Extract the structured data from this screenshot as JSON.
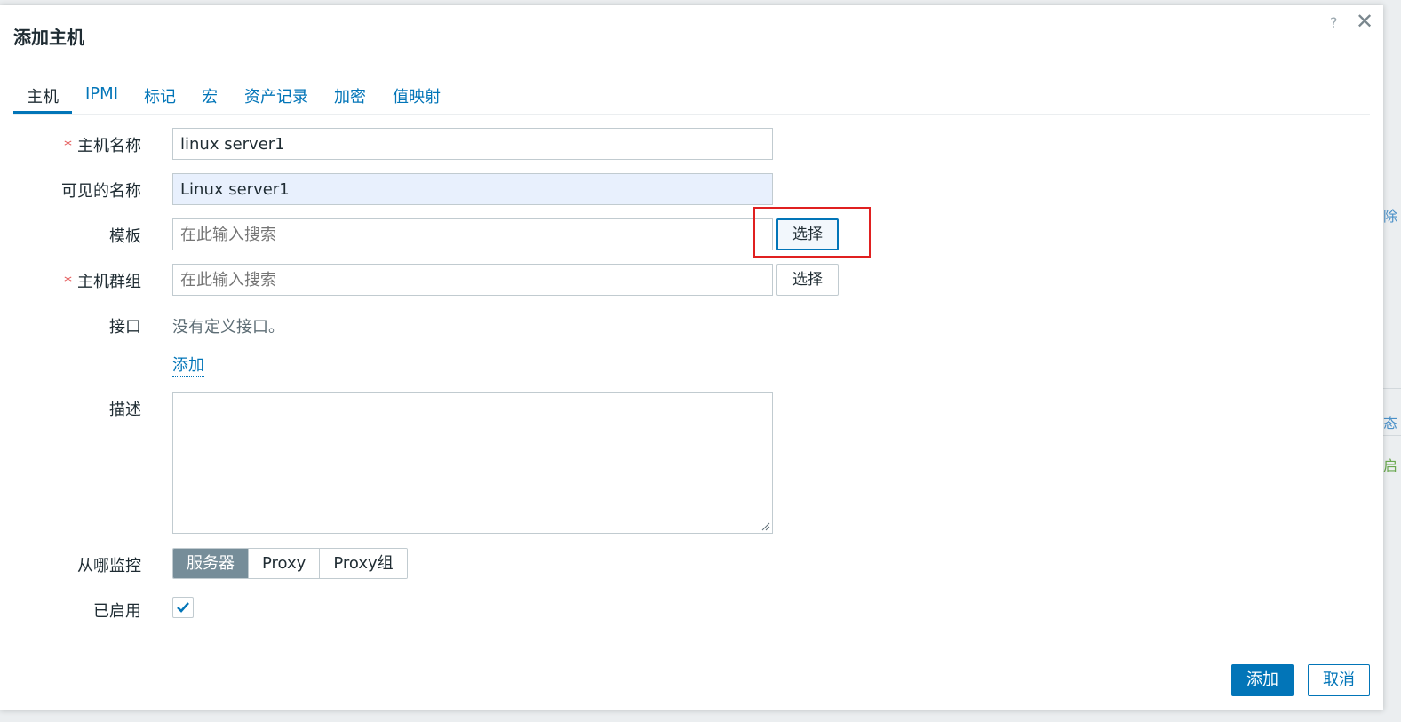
{
  "dialog": {
    "title": "添加主机",
    "help_glyph": "?",
    "close_glyph": "✕"
  },
  "tabs": [
    {
      "label": "主机",
      "active": true
    },
    {
      "label": "IPMI"
    },
    {
      "label": "标记"
    },
    {
      "label": "宏"
    },
    {
      "label": "资产记录"
    },
    {
      "label": "加密"
    },
    {
      "label": "值映射"
    }
  ],
  "form": {
    "required_mark": "*",
    "host_name": {
      "label": "主机名称",
      "value": "linux server1"
    },
    "visible_name": {
      "label": "可见的名称",
      "value": "Linux server1"
    },
    "templates": {
      "label": "模板",
      "placeholder": "在此输入搜索",
      "select_label": "选择"
    },
    "host_groups": {
      "label": "主机群组",
      "placeholder": "在此输入搜索",
      "select_label": "选择"
    },
    "interfaces": {
      "label": "接口",
      "empty_text": "没有定义接口。",
      "add_link": "添加"
    },
    "description": {
      "label": "描述",
      "value": ""
    },
    "monitored_by": {
      "label": "从哪监控",
      "options": [
        "服务器",
        "Proxy",
        "Proxy组"
      ],
      "selected": "服务器"
    },
    "enabled": {
      "label": "已启用",
      "checked": true
    }
  },
  "footer": {
    "add_label": "添加",
    "cancel_label": "取消"
  },
  "backdrop_fragments": [
    "除",
    "态",
    "启"
  ],
  "colors": {
    "accent": "#0275b8",
    "required": "#e45959",
    "highlight": "#e02020",
    "segment_active": "#768d99"
  }
}
